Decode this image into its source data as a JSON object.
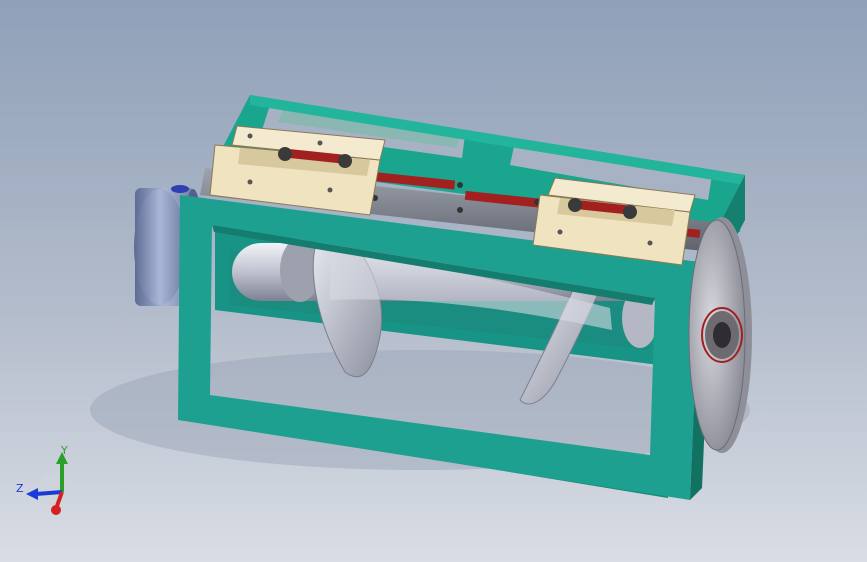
{
  "viewport": {
    "background_top": "#8fa0b8",
    "background_bottom": "#d9dde5"
  },
  "model": {
    "frame_color": "#1ea090",
    "carriage_color": "#efe3c0",
    "spring_color": "#a32020",
    "screw_color": "#c9ccd6",
    "pulley_color": "#b9b9c4",
    "motor_color": "#7f8fb5"
  },
  "triad": {
    "x_label": "",
    "y_label": "Y",
    "z_label": "Z",
    "x_color": "#d42020",
    "y_color": "#2aa02a",
    "z_color": "#1c3ad6"
  }
}
